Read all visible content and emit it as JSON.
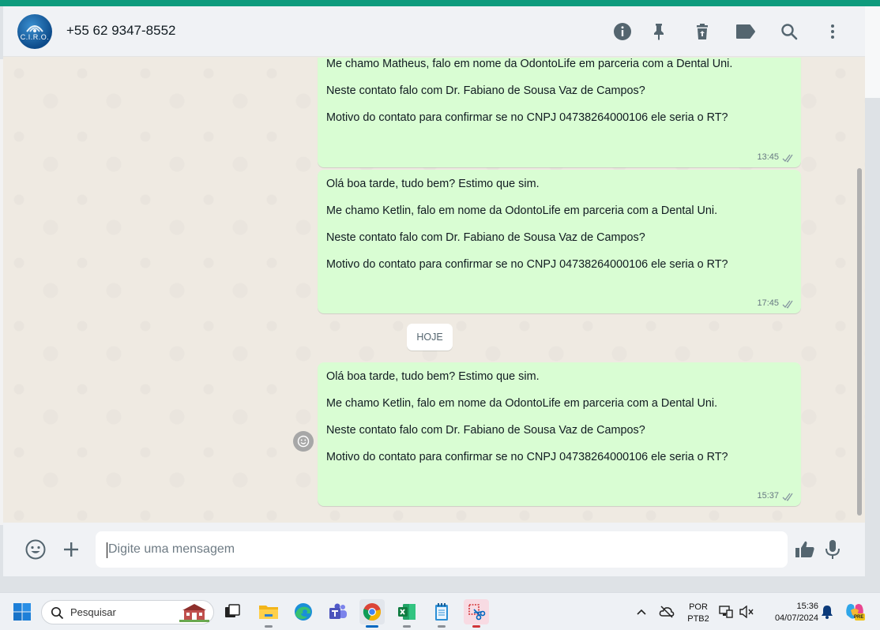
{
  "header": {
    "contact_name": "+55 62 9347-8552",
    "avatar_text": "C.I.R.O.",
    "icons": [
      "info-icon",
      "pin-icon",
      "delete-icon",
      "label-icon",
      "search-icon",
      "menu-icon"
    ]
  },
  "messages": [
    {
      "lines": [
        "Me chamo Matheus, falo em nome da OdontoLife em parceria com a Dental Uni.",
        "Neste contato falo com Dr. Fabiano de Sousa Vaz de Campos?",
        "Motivo do contato para confirmar se no CNPJ 04738264000106 ele seria o RT?"
      ],
      "time": "13:45"
    },
    {
      "lines": [
        "Olá boa tarde, tudo bem? Estimo que sim.",
        "Me chamo Ketlin, falo em nome da OdontoLife em parceria com a Dental Uni.",
        "Neste contato falo com Dr. Fabiano de Sousa Vaz de Campos?",
        "Motivo do contato para confirmar se no CNPJ 04738264000106 ele seria o RT?"
      ],
      "time": "17:45"
    },
    {
      "lines": [
        "Olá boa tarde, tudo bem? Estimo que sim.",
        "Me chamo Ketlin, falo em nome da OdontoLife em parceria com a Dental Uni.",
        "Neste contato falo com Dr. Fabiano de Sousa Vaz de Campos?",
        "Motivo do contato para confirmar se no CNPJ 04738264000106 ele seria o RT?"
      ],
      "time": "15:37"
    }
  ],
  "day_divider": "HOJE",
  "composer": {
    "placeholder": "Digite uma mensagem",
    "value": ""
  },
  "taskbar": {
    "search_placeholder": "Pesquisar",
    "apps": [
      "windows-start-icon",
      "task-view-icon",
      "file-explorer-icon",
      "edge-icon",
      "teams-icon",
      "chrome-icon",
      "excel-icon",
      "notepad-icon",
      "snipping-tool-icon"
    ],
    "active_app": "chrome-icon",
    "language": "POR",
    "keyboard": "PTB2",
    "time": "15:36",
    "date": "04/07/2024",
    "copilot_badge": "PRE"
  },
  "colors": {
    "outgoing_bubble": "#d9fdd3",
    "chat_background": "#efeae2",
    "header_background": "#f0f2f5",
    "accent_stripe": "#0f9b7d",
    "read_ticks": "#667781"
  }
}
